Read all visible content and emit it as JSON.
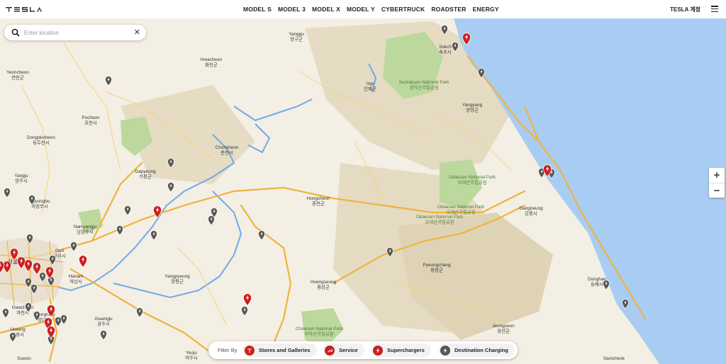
{
  "header": {
    "logo": "TESLA",
    "nav": [
      "MODEL S",
      "MODEL 3",
      "MODEL X",
      "MODEL Y",
      "CYBERTRUCK",
      "ROADSTER",
      "ENERGY"
    ],
    "account_label": "TESLA 계정"
  },
  "search": {
    "placeholder": "Enter location",
    "value": ""
  },
  "zoom": {
    "in": "+",
    "out": "−"
  },
  "filter": {
    "label": "Filter By",
    "items": [
      {
        "label": "Stores and Galleries",
        "icon": "tesla-logo-icon",
        "color": "#cc1f1f"
      },
      {
        "label": "Service",
        "icon": "wrench-icon",
        "color": "#cc1f1f"
      },
      {
        "label": "Superchargers",
        "icon": "lightning-icon",
        "color": "#cc1f1f"
      },
      {
        "label": "Destination Charging",
        "icon": "lightning-icon",
        "color": "#555555"
      }
    ]
  },
  "map": {
    "colors": {
      "land": "#f3efe4",
      "sea": "#a9cdf2",
      "road": "#f2b23a",
      "river": "#6fa6e6",
      "mountain": "#d9cfb2",
      "park": "#b8d69a"
    },
    "labels": {
      "yanggu": "Yanggu\n양구군",
      "hwacheon": "Hwacheon\n화천군",
      "yeoncheon": "Yeoncheon\n연천군",
      "inje": "Inje\n인제군",
      "seoraksan": "Seoraksan National Park\n설악산국립공원",
      "sokcho": "Sokch\n속초시",
      "yangyang": "Yangyang\n양양군",
      "pocheon": "Pocheon\n포천시",
      "dongducheon": "Dongducheon\n동두천시",
      "chuncheon": "Chuncheon\n춘천시",
      "gapyeong": "Gapyeong\n가평군",
      "yangju": "Yangju\n양주시",
      "uijeongbu": "Uijeongbu\n의정부시",
      "hongcheon": "Hongcheon\n홍천군",
      "odaesan1": "Odaesan National Park\n오대산국립공원",
      "odaesan2": "Odaesan National Park\n오대산국립공원",
      "odaesan3": "Odaesan National Park\n오대산국립공원",
      "gangneung": "Gangneung\n강릉시",
      "namyangju": "Namyangju\n남양주시",
      "guri": "Guri\n구리시",
      "hanam": "Hanam\n하남시",
      "seoul": "서울",
      "yangpyeong": "Yangpyeong\n양평군",
      "pyeongchang": "Pyeongchang\n평창군",
      "hoengseong": "Hoengseong\n횡성군",
      "donghae": "Donghae\n동해시",
      "gwacheon": "Gwacheon\n과천시",
      "seongnam": "Seongnam\n성남시",
      "gwangju": "Gwangju\n광주시",
      "uiwang": "Uiwang\n의왕시",
      "chiaksan": "Chiaksan National Park\n치악산국립공원",
      "jeongseon": "Jeongseon\n정선군",
      "yeoju": "Yeoju\n여주시",
      "suwon": "Suwon",
      "samcheok": "Samcheok"
    }
  }
}
